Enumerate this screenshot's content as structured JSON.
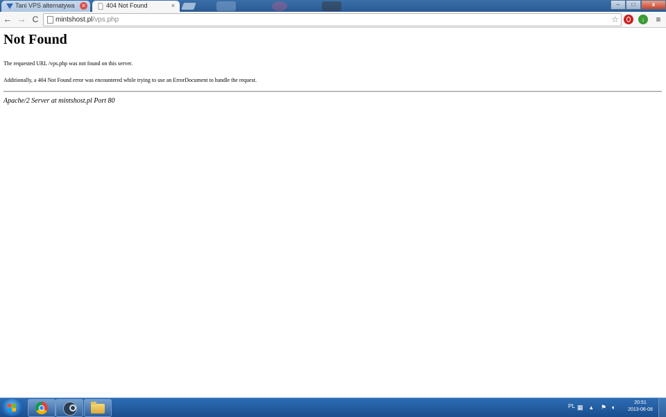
{
  "browser": {
    "tabs": [
      {
        "title": "Tani VPS alternatywa kont",
        "active": false
      },
      {
        "title": "404 Not Found",
        "active": true
      }
    ],
    "tab_close_glyph": "×",
    "url": {
      "host": "mintshost.pl",
      "path": "/vps.php"
    },
    "toolbar": {
      "back_icon": "←",
      "forward_icon": "→",
      "reload_icon": "C",
      "star_icon": "☆",
      "menu_icon": "≡"
    },
    "window_controls": {
      "minimize": "–",
      "maximize": "□",
      "close": "x"
    }
  },
  "page": {
    "title": "Not Found",
    "paragraph1": "The requested URL /vps.php was not found on this server.",
    "paragraph2": "Additionally, a 404 Not Found error was encountered while trying to use an ErrorDocument to handle the request.",
    "address": "Apache/2 Server at mintshost.pl Port 80"
  },
  "taskbar": {
    "pinned": [
      "chrome",
      "steam",
      "explorer"
    ],
    "tray": {
      "language": "PL",
      "clock_time": "20:51",
      "clock_date": "2013-06-08"
    }
  },
  "colors": {
    "titlebar": "#2a5a93",
    "taskbar": "#1b4e8e",
    "close_red": "#c7432d"
  }
}
